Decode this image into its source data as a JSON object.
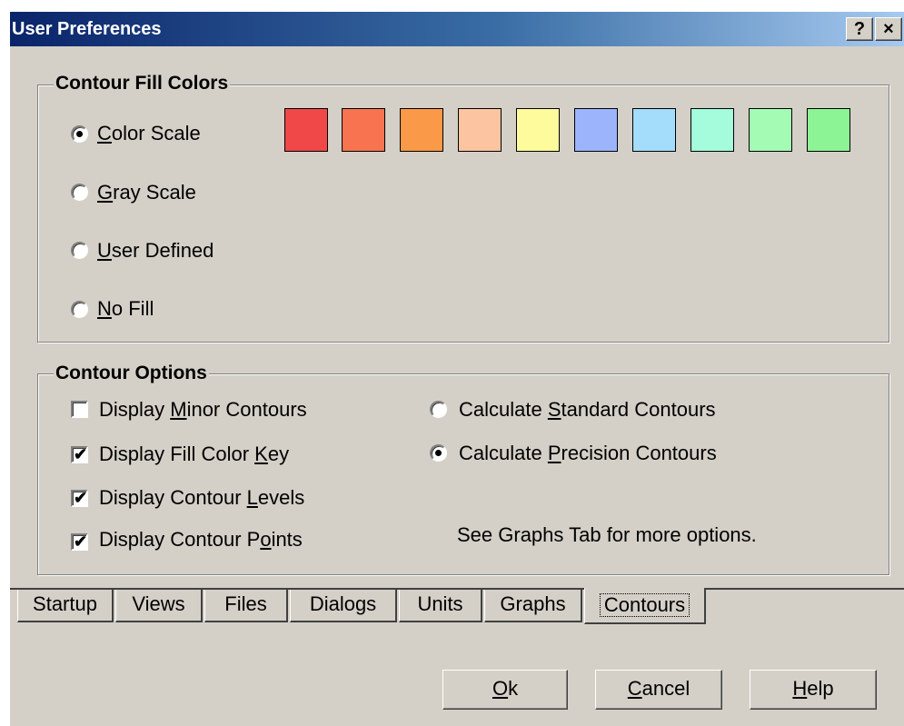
{
  "window": {
    "title": "User Preferences",
    "help_label": "?",
    "close_label": "×"
  },
  "fill_group": {
    "title": "Contour Fill Colors",
    "options": [
      {
        "mnemonic": "C",
        "rest": "olor Scale",
        "checked": true
      },
      {
        "mnemonic": "G",
        "rest": "ray Scale",
        "checked": false
      },
      {
        "mnemonic": "U",
        "rest": "ser Defined",
        "checked": false
      },
      {
        "mnemonic": "N",
        "rest": "o Fill",
        "checked": false
      }
    ],
    "swatches": [
      "#f04848",
      "#f87450",
      "#fa9a48",
      "#fcc4a0",
      "#fdfb9c",
      "#9cb4fc",
      "#a4dcfc",
      "#a4fcdc",
      "#a4fcb4",
      "#8cf494"
    ]
  },
  "options_group": {
    "title": "Contour Options",
    "checks": [
      {
        "pre": "Display ",
        "mnemonic": "M",
        "post": "inor Contours",
        "checked": false
      },
      {
        "pre": "Display Fill Color ",
        "mnemonic": "K",
        "post": "ey",
        "checked": true
      },
      {
        "pre": "Display Contour ",
        "mnemonic": "L",
        "post": "evels",
        "checked": true
      },
      {
        "pre": "Display Contour P",
        "mnemonic": "o",
        "post": "ints",
        "checked": true
      }
    ],
    "radios": [
      {
        "pre": "Calculate ",
        "mnemonic": "S",
        "post": "tandard Contours",
        "checked": false
      },
      {
        "pre": "Calculate ",
        "mnemonic": "P",
        "post": "recision Contours",
        "checked": true
      }
    ],
    "note": "See Graphs Tab for more options."
  },
  "tabs": [
    "Startup",
    "Views",
    "Files",
    "Dialogs",
    "Units",
    "Graphs",
    "Contours"
  ],
  "active_tab": "Contours",
  "buttons": [
    {
      "mnemonic": "O",
      "rest": "k"
    },
    {
      "mnemonic": "C",
      "rest": "ancel"
    },
    {
      "mnemonic": "H",
      "rest": "elp"
    }
  ]
}
